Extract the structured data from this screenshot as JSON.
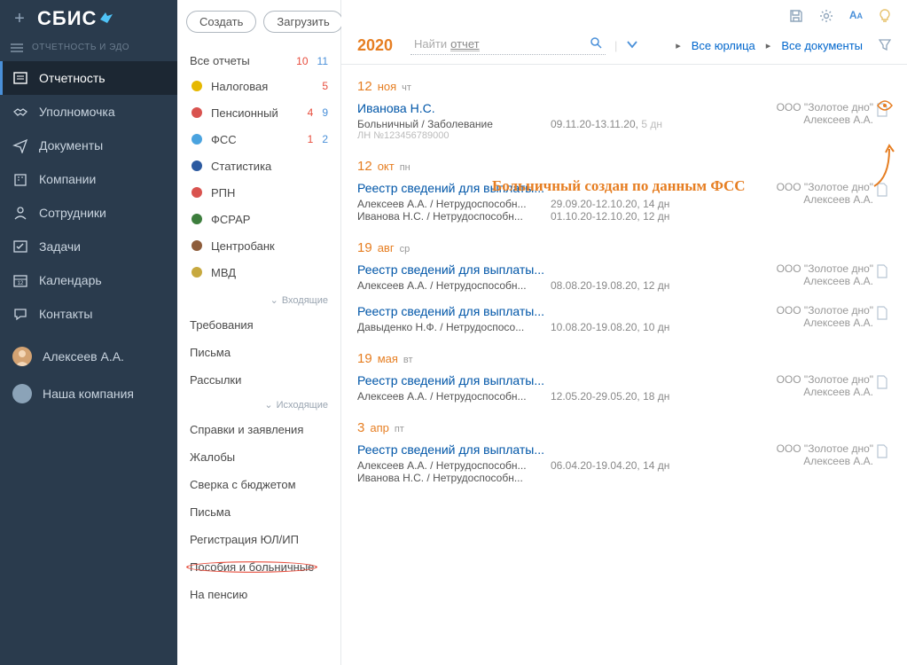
{
  "app": {
    "logo": "СБИС",
    "subtitle": "ОТЧЕТНОСТЬ И ЭДО"
  },
  "top_icons": {
    "save": "save-icon",
    "gear": "gear-icon",
    "font": "AA",
    "bulb": "bulb-icon"
  },
  "nav": [
    {
      "label": "Отчетность",
      "active": true,
      "icon": "report"
    },
    {
      "label": "Уполномочка",
      "icon": "handshake"
    },
    {
      "label": "Документы",
      "icon": "send"
    },
    {
      "label": "Компании",
      "icon": "building"
    },
    {
      "label": "Сотрудники",
      "icon": "user"
    },
    {
      "label": "Задачи",
      "icon": "check"
    },
    {
      "label": "Календарь",
      "icon": "calendar"
    },
    {
      "label": "Контакты",
      "icon": "chat"
    }
  ],
  "user": {
    "name": "Алексеев А.А.",
    "company": "Наша компания"
  },
  "midbuttons": {
    "create": "Создать",
    "upload": "Загрузить"
  },
  "categories": {
    "header": {
      "label": "Все отчеты",
      "red": "10",
      "blue": "11"
    },
    "items": [
      {
        "label": "Налоговая",
        "red": "5",
        "blue": "",
        "color": "#e6b800"
      },
      {
        "label": "Пенсионный",
        "red": "4",
        "blue": "9",
        "color": "#d9534f"
      },
      {
        "label": "ФСС",
        "red": "1",
        "blue": "2",
        "color": "#4aa3df"
      },
      {
        "label": "Статистика",
        "color": "#2c5aa0"
      },
      {
        "label": "РПН",
        "color": "#d9534f"
      },
      {
        "label": "ФСРАР",
        "color": "#3d7e3d"
      },
      {
        "label": "Центробанк",
        "color": "#8e5d3b"
      },
      {
        "label": "МВД",
        "color": "#c7a93f"
      }
    ]
  },
  "sections": {
    "incoming": {
      "title": "Входящие",
      "items": [
        "Требования",
        "Письма",
        "Рассылки"
      ]
    },
    "outgoing": {
      "title": "Исходящие",
      "items": [
        "Справки и заявления",
        "Жалобы",
        "Сверка с бюджетом",
        "Письма",
        "Регистрация ЮЛ/ИП",
        "Пособия и больничные",
        "На пенсию"
      ]
    }
  },
  "toolbar": {
    "year": "2020",
    "search_prefix": "Найти",
    "search_kw": "отчет",
    "bc_all_legal": "Все юрлица",
    "bc_all_docs": "Все документы"
  },
  "annotation": "Больничный создан по данным ФСС",
  "groups": [
    {
      "date": "12 ноя",
      "weekday": "чт",
      "entries": [
        {
          "title": "Иванова Н.С.",
          "sub1": "Больничный / Заболевание",
          "sub2": "ЛН №123456789000",
          "dates": "09.11.20-13.11.20,",
          "days": "5 дн",
          "org": "ООО \"Золотое дно\"",
          "author": "Алексеев А.А.",
          "eye": true
        }
      ]
    },
    {
      "date": "12 окт",
      "weekday": "пн",
      "entries": [
        {
          "title": "Реестр сведений для выплаты...",
          "lines": [
            {
              "who": "Алексеев А.А. / Нетрудоспособн...",
              "dates": "29.09.20-12.10.20, 14 дн"
            },
            {
              "who": "Иванова Н.С. / Нетрудоспособн...",
              "dates": "01.10.20-12.10.20, 12 дн"
            }
          ],
          "org": "ООО \"Золотое дно\"",
          "author": "Алексеев А.А."
        }
      ]
    },
    {
      "date": "19 авг",
      "weekday": "ср",
      "entries": [
        {
          "title": "Реестр сведений для выплаты...",
          "lines": [
            {
              "who": "Алексеев А.А. / Нетрудоспособн...",
              "dates": "08.08.20-19.08.20, 12 дн"
            }
          ],
          "org": "ООО \"Золотое дно\"",
          "author": "Алексеев А.А."
        },
        {
          "title": "Реестр сведений для выплаты...",
          "lines": [
            {
              "who": "Давыденко Н.Ф. / Нетрудоспосо...",
              "dates": "10.08.20-19.08.20, 10 дн"
            }
          ],
          "org": "ООО \"Золотое дно\"",
          "author": "Алексеев А.А."
        }
      ]
    },
    {
      "date": "19 мая",
      "weekday": "вт",
      "entries": [
        {
          "title": "Реестр сведений для выплаты...",
          "lines": [
            {
              "who": "Алексеев А.А. / Нетрудоспособн...",
              "dates": "12.05.20-29.05.20, 18 дн"
            }
          ],
          "org": "ООО \"Золотое дно\"",
          "author": "Алексеев А.А."
        }
      ]
    },
    {
      "date": "3 апр",
      "weekday": "пт",
      "entries": [
        {
          "title": "Реестр сведений для выплаты...",
          "lines": [
            {
              "who": "Алексеев А.А. / Нетрудоспособн...",
              "dates": "06.04.20-19.04.20, 14 дн"
            },
            {
              "who": "Иванова Н.С. / Нетрудоспособн...",
              "dates": ""
            }
          ],
          "org": "ООО \"Золотое дно\"",
          "author": "Алексеев А.А."
        }
      ]
    }
  ]
}
